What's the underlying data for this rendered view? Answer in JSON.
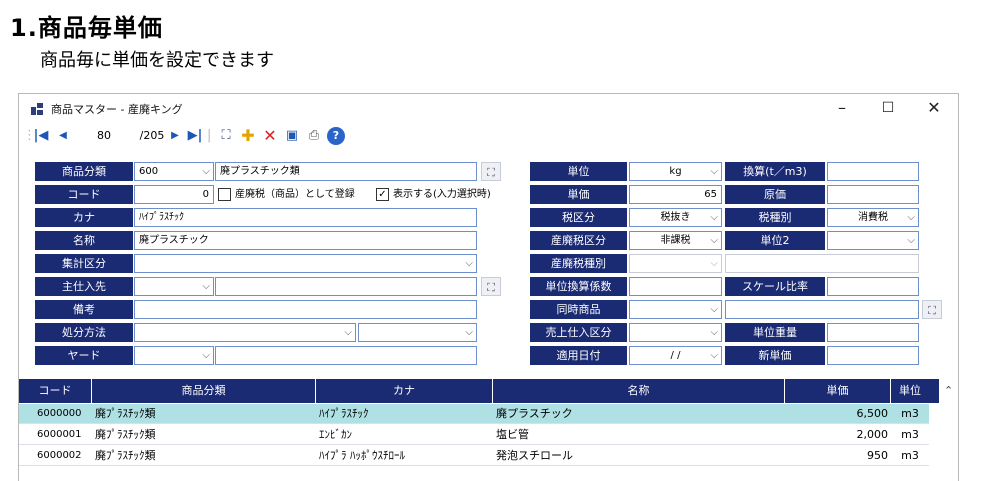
{
  "page": {
    "heading": "1.商品毎単価",
    "subheading": "商品毎に単価を設定できます"
  },
  "window": {
    "title": "商品マスター - 産廃キング",
    "minimize": "–",
    "maximize": "☐",
    "close": "✕"
  },
  "toolbar": {
    "record_current": "80",
    "record_total": "/205"
  },
  "form": {
    "bunrui_label": "商品分類",
    "bunrui_code": "600",
    "bunrui_name": "廃プラスチック類",
    "code_label": "コード",
    "code_value": "0",
    "sanpai_tax_check": "産廃税（商品）として登録",
    "display_check": "表示する(入力選択時)",
    "kana_label": "カナ",
    "kana_value": "ﾊｲﾌﾟﾗｽﾁｯｸ",
    "name_label": "名称",
    "name_value": "廃プラスチック",
    "shukei_label": "集計区分",
    "shiire_label": "主仕入先",
    "biko_label": "備考",
    "shobun_label": "処分方法",
    "yard_label": "ヤード",
    "tani_label": "単位",
    "tani_value": "kg",
    "kansan_label": "換算(t／m3)",
    "tanka_label": "単価",
    "tanka_value": "65",
    "genka_label": "原価",
    "zeiku_label": "税区分",
    "zeiku_value": "税抜き",
    "zeishu_label": "税種別",
    "zeishu_value": "消費税",
    "sanpai_zeiku_label": "産廃税区分",
    "sanpai_zeiku_value": "非課税",
    "tani2_label": "単位2",
    "sanpai_zeishu_label": "産廃税種別",
    "tani_kansan_label": "単位換算係数",
    "scale_label": "スケール比率",
    "doji_label": "同時商品",
    "uriage_label": "売上仕入区分",
    "tani_juryo_label": "単位重量",
    "tekiyo_label": "適用日付",
    "tekiyo_value": "/    /",
    "shin_tanka_label": "新単価"
  },
  "grid": {
    "headers": [
      "コード",
      "商品分類",
      "カナ",
      "名称",
      "単価",
      "単位"
    ],
    "rows": [
      {
        "code": "6000000",
        "bunrui": "廃ﾌﾟﾗｽﾁｯｸ類",
        "kana": "ﾊｲﾌﾟﾗｽﾁｯｸ",
        "name": "廃プラスチック",
        "price": "6,500",
        "unit": "m3"
      },
      {
        "code": "6000001",
        "bunrui": "廃ﾌﾟﾗｽﾁｯｸ類",
        "kana": "ｴﾝﾋﾞｶﾝ",
        "name": "塩ビ管",
        "price": "2,000",
        "unit": "m3"
      },
      {
        "code": "6000002",
        "bunrui": "廃ﾌﾟﾗｽﾁｯｸ類",
        "kana": "ﾊｲﾌﾟﾗ ﾊｯﾎﾟｳｽﾁﾛｰﾙ",
        "name": "発泡スチロール",
        "price": "950",
        "unit": "m3"
      }
    ]
  }
}
